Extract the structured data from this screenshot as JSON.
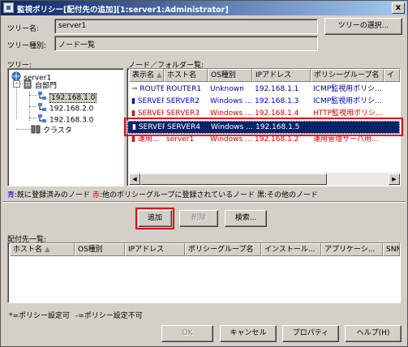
{
  "window": {
    "title": "監視ポリシー[配付先の追加][1:server1:Administrator]",
    "close_label": "x"
  },
  "tree_name": {
    "label": "ツリー名:",
    "value": "server1",
    "select_button": "ツリーの選択..."
  },
  "tree_type": {
    "label": "ツリー種別:",
    "value": "ノード一覧"
  },
  "tree": {
    "label": "ツリー:",
    "nodes": [
      {
        "label": "server1"
      },
      {
        "label": "自部門"
      },
      {
        "label": "192.168.1.0"
      },
      {
        "label": "192.168.2.0"
      },
      {
        "label": "192.168.3.0"
      },
      {
        "label": "クラスタ"
      }
    ]
  },
  "node_list": {
    "label": "ノード／フォルダー覧:",
    "columns": [
      "表示名",
      "ホスト名",
      "OS種別",
      "IPアドレス",
      "ポリシーグループ名",
      "イ"
    ],
    "rows": [
      {
        "cells": [
          "ROUTER1",
          "ROUTER1",
          "Unknown",
          "192.168.1.1",
          "ICMP監視用ポリシ..."
        ],
        "color": "#00008b"
      },
      {
        "cells": [
          "SERVER2",
          "SERVER2",
          "Windows ...",
          "192.168.1.3",
          "ICMP監視用ポリシ..."
        ],
        "color": "#0000cc"
      },
      {
        "cells": [
          "SERVER3",
          "SERVER3",
          "Windows ...",
          "192.168.1.4",
          "HTTP監視用ポリシ..."
        ],
        "color": "#cc0000"
      },
      {
        "cells": [
          "SERVER4",
          "SERVER4",
          "Windows ...",
          "192.168.1.5",
          ""
        ],
        "color": "#ffffff"
      },
      {
        "cells": [
          "運用...",
          "server1",
          "Windows ...",
          "192.168.1.2",
          "運用管理サーバ用..."
        ],
        "color": "#cc0000"
      }
    ]
  },
  "legend": {
    "blue_key": "青",
    "blue_text": ":既に登録済みのノード ",
    "red_key": "赤",
    "red_text": ":他のポリシーグループに登録されているノード 黒:その他のノード"
  },
  "buttons": {
    "add": "追加",
    "delete": "削除",
    "search": "検索..."
  },
  "distribution": {
    "label": "配付先一覧:",
    "columns": [
      "ホスト名",
      "OS種別",
      "IPアドレス",
      "ポリシーグループ名",
      "インストール...",
      "アプリケーシ...",
      "SNM"
    ]
  },
  "notes": {
    "settable": "*=ポリシー設定可",
    "not_settable": "-=ポリシー設定不可"
  },
  "footer": {
    "ok": "OK",
    "cancel": "キャンセル",
    "properties": "プロパティ",
    "help": "ヘルプ(H)"
  },
  "colors": {
    "selection": "#0a246a",
    "highlight_box": "#e00000",
    "registered": "#0000cc",
    "other_group": "#cc0000"
  }
}
